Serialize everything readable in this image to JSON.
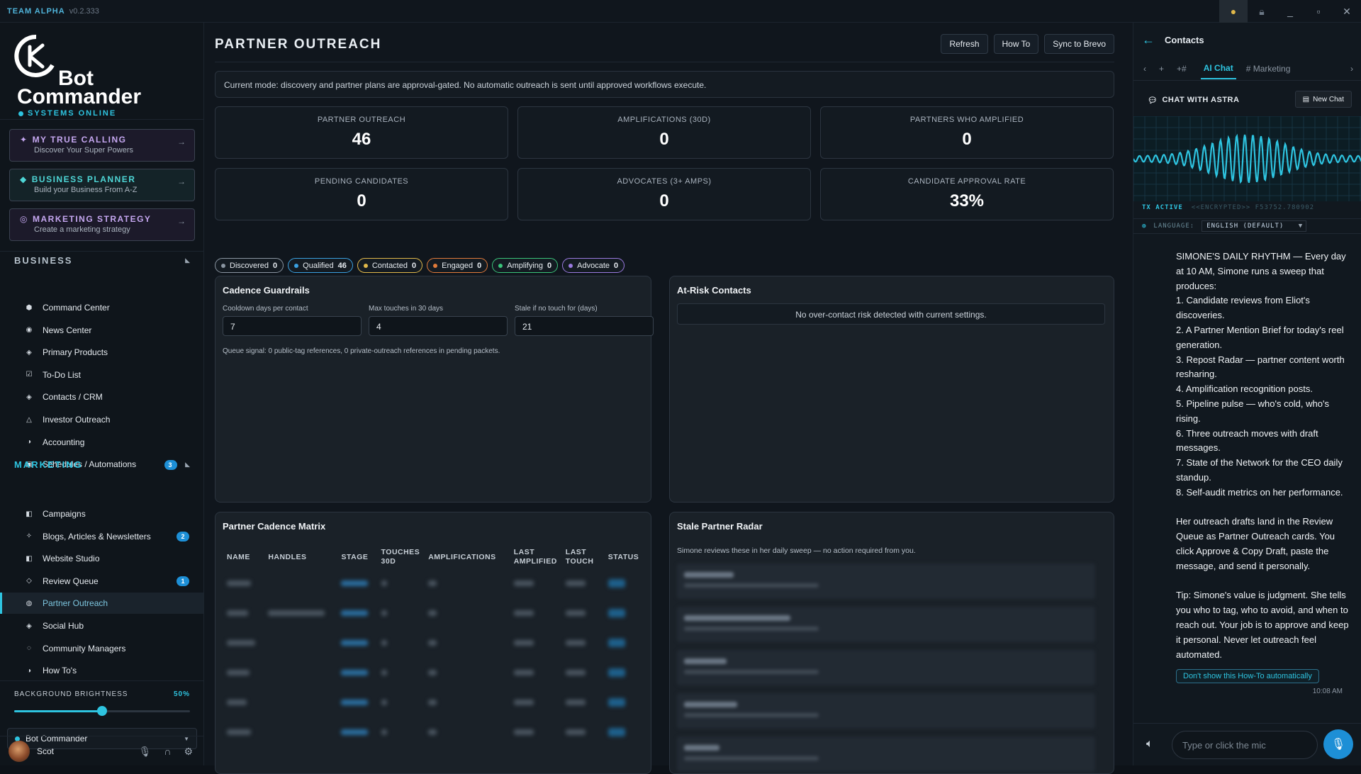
{
  "titlebar": {
    "brand": "TEAM ALPHA",
    "version": "v0.2.333"
  },
  "sidebar": {
    "logo_line1": "Bot",
    "logo_line2": "Commander",
    "status": "SYSTEMS ONLINE",
    "promos": [
      {
        "title": "MY TRUE CALLING",
        "subtitle": "Discover Your Super Powers"
      },
      {
        "title": "BUSINESS PLANNER",
        "subtitle": "Build your Business From A-Z"
      },
      {
        "title": "MARKETING STRATEGY",
        "subtitle": "Create a marketing strategy"
      }
    ],
    "business_heading": "BUSINESS",
    "business_items": [
      {
        "label": "Command Center",
        "icon": "hexagon-icon"
      },
      {
        "label": "News Center",
        "icon": "radio-icon"
      },
      {
        "label": "Primary Products",
        "icon": "diamond-icon"
      },
      {
        "label": "To-Do List",
        "icon": "checkbox-icon"
      },
      {
        "label": "Contacts / CRM",
        "icon": "diamond-icon"
      },
      {
        "label": "Investor Outreach",
        "icon": "triangle-icon"
      },
      {
        "label": "Accounting",
        "icon": "half-circle-icon"
      },
      {
        "label": "Schedules / Automations",
        "icon": "square-icon"
      }
    ],
    "marketing_heading": "MARKETING",
    "marketing_badge": "3",
    "marketing_items": [
      {
        "label": "Campaigns",
        "icon": "panel-icon",
        "badge": ""
      },
      {
        "label": "Blogs, Articles & Newsletters",
        "icon": "sparkle-icon",
        "badge": "2"
      },
      {
        "label": "Website Studio",
        "icon": "half-square-icon",
        "badge": ""
      },
      {
        "label": "Review Queue",
        "icon": "diamond-outline-icon",
        "badge": "1"
      },
      {
        "label": "Partner Outreach",
        "icon": "globe-icon",
        "badge": ""
      },
      {
        "label": "Social Hub",
        "icon": "diamond-icon",
        "badge": ""
      },
      {
        "label": "Community Managers",
        "icon": "chat-icon",
        "badge": ""
      },
      {
        "label": "How To's",
        "icon": "half-circle-icon",
        "badge": ""
      }
    ],
    "brightness_label": "BACKGROUND BRIGHTNESS",
    "brightness_value": "50%",
    "brightness_fraction": 0.5,
    "agent": "Bot Commander",
    "user": "Scot"
  },
  "main": {
    "title": "PARTNER OUTREACH",
    "buttons": {
      "refresh": "Refresh",
      "howto": "How To",
      "sync": "Sync to Brevo"
    },
    "notice": "Current mode: discovery and partner plans are approval-gated. No automatic outreach is sent until approved workflows execute.",
    "stats": [
      {
        "label": "PARTNER OUTREACH",
        "value": "46"
      },
      {
        "label": "AMPLIFICATIONS (30D)",
        "value": "0"
      },
      {
        "label": "PARTNERS WHO AMPLIFIED",
        "value": "0"
      },
      {
        "label": "PENDING CANDIDATES",
        "value": "0"
      },
      {
        "label": "ADVOCATES (3+ AMPS)",
        "value": "0"
      },
      {
        "label": "CANDIDATE APPROVAL RATE",
        "value": "33%"
      }
    ],
    "chips": [
      {
        "label": "Discovered",
        "count": "0",
        "color": "#8a95a1"
      },
      {
        "label": "Qualified",
        "count": "46",
        "color": "#3aa0e0"
      },
      {
        "label": "Contacted",
        "count": "0",
        "color": "#e0b84a"
      },
      {
        "label": "Engaged",
        "count": "0",
        "color": "#e07a3a"
      },
      {
        "label": "Amplifying",
        "count": "0",
        "color": "#3ac47a"
      },
      {
        "label": "Advocate",
        "count": "0",
        "color": "#9a7ae0"
      }
    ],
    "cadence": {
      "title": "Cadence Guardrails",
      "cooldown_label": "Cooldown days per contact",
      "cooldown_value": "7",
      "touches_label": "Max touches in 30 days",
      "touches_value": "4",
      "stale_label": "Stale if no touch for (days)",
      "stale_value": "21",
      "queue_signal": "Queue signal: 0 public-tag references, 0 private-outreach references in pending packets."
    },
    "atrisk": {
      "title": "At-Risk Contacts",
      "empty": "No over-contact risk detected with current settings."
    },
    "matrix": {
      "title": "Partner Cadence Matrix",
      "headers": [
        "NAME",
        "HANDLES",
        "STAGE",
        "TOUCHES 30D",
        "AMPLIFICATIONS",
        "LAST AMPLIFIED",
        "LAST TOUCH",
        "STATUS"
      ]
    },
    "radar": {
      "title": "Stale Partner Radar",
      "subtitle": "Simone reviews these in her daily sweep — no action required from you."
    }
  },
  "rpanel": {
    "title": "Contacts",
    "tabs": {
      "ai_chat": "AI Chat",
      "marketing": "# Marketing"
    },
    "chat_title": "CHAT WITH ASTRA",
    "new_chat": "New Chat",
    "tx_active": "TX ACTIVE",
    "encrypted": "<<ENCRYPTED>> F53752.780902",
    "language_label": "LANGUAGE:",
    "language_value": "ENGLISH (DEFAULT)",
    "message_intro": "SIMONE'S DAILY RHYTHM — Every day at 10 AM, Simone runs a sweep that produces:",
    "message_items": [
      "1. Candidate reviews from Eliot's discoveries.",
      "2. A Partner Mention Brief for today's reel generation.",
      "3. Repost Radar — partner content worth resharing.",
      "4. Amplification recognition posts.",
      "5. Pipeline pulse — who's cold, who's rising.",
      "6. Three outreach moves with draft messages.",
      "7. State of the Network for the CEO daily standup.",
      "8. Self-audit metrics on her performance."
    ],
    "message_p2": "Her outreach drafts land in the Review Queue as Partner Outreach cards. You click Approve & Copy Draft, paste the message, and send it personally.",
    "message_p3": "Tip: Simone's value is judgment. She tells you who to tag, who to avoid, and when to reach out. Your job is to approve and keep it personal. Never let outreach feel automated.",
    "howto_toggle": "Don't show this How-To automatically",
    "timestamp": "10:08 AM",
    "input_placeholder": "Type or click the mic"
  }
}
